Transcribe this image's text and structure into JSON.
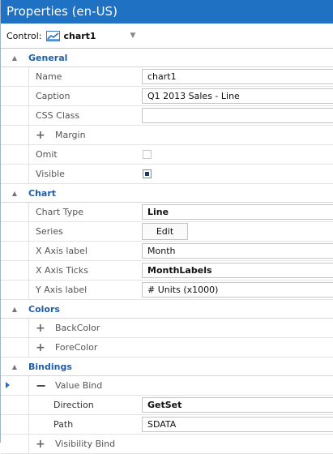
{
  "window": {
    "title": "Properties (en-US)"
  },
  "control": {
    "label": "Control:",
    "selected": "chart1"
  },
  "sections": {
    "general": {
      "label": "General",
      "name_label": "Name",
      "name_value": "chart1",
      "caption_label": "Caption",
      "caption_value": "Q1 2013 Sales - Line",
      "css_label": "CSS Class",
      "css_value": "",
      "margin_label": "Margin",
      "omit_label": "Omit",
      "omit_checked": false,
      "visible_label": "Visible",
      "visible_checked": true
    },
    "chart": {
      "label": "Chart",
      "type_label": "Chart Type",
      "type_value": "Line",
      "series_label": "Series",
      "series_button": "Edit",
      "xlabel_label": "X Axis label",
      "xlabel_value": "Month",
      "xticks_label": "X Axis Ticks",
      "xticks_value": "MonthLabels",
      "ylabel_label": "Y Axis label",
      "ylabel_value": "# Units (x1000)"
    },
    "colors": {
      "label": "Colors",
      "back_label": "BackColor",
      "fore_label": "ForeColor"
    },
    "bindings": {
      "label": "Bindings",
      "value_bind_label": "Value Bind",
      "direction_label": "Direction",
      "direction_value": "GetSet",
      "path_label": "Path",
      "path_value": "SDATA",
      "visibility_bind_label": "Visibility Bind"
    }
  },
  "icons": {
    "collapse": "collapse-triangle-icon",
    "expand": "plus-icon",
    "chart": "line-chart-icon"
  },
  "colors": {
    "titlebar": "#1f72c3",
    "category_text": "#1f5fa8"
  }
}
